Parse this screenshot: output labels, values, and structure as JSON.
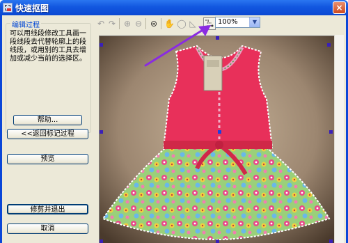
{
  "window": {
    "title": "快速抠图",
    "close_label": "×"
  },
  "left_panel": {
    "group_title": "编辑过程",
    "description": "可以用线段修改工具画一段线段去代替轮廓上的段线段，或用别的工具去增加或减少当前的选择区。",
    "help_button": "帮助...",
    "back_button": "<<返回标记过程",
    "preview_button": "预览",
    "crop_exit_button": "修剪并退出",
    "cancel_button": "取消"
  },
  "toolbar": {
    "zoom_value": "100%",
    "icons": [
      "undo-icon",
      "redo-icon",
      "zoom-in-icon",
      "zoom-out-icon",
      "fit-icon",
      "hand-icon",
      "lasso-icon",
      "polygon-lasso-icon",
      "segment-edit-icon"
    ]
  },
  "colors": {
    "titlebar": "#0a46d8",
    "annotation_arrow": "#8a2be2",
    "selection_handle": "#3a20b8"
  }
}
